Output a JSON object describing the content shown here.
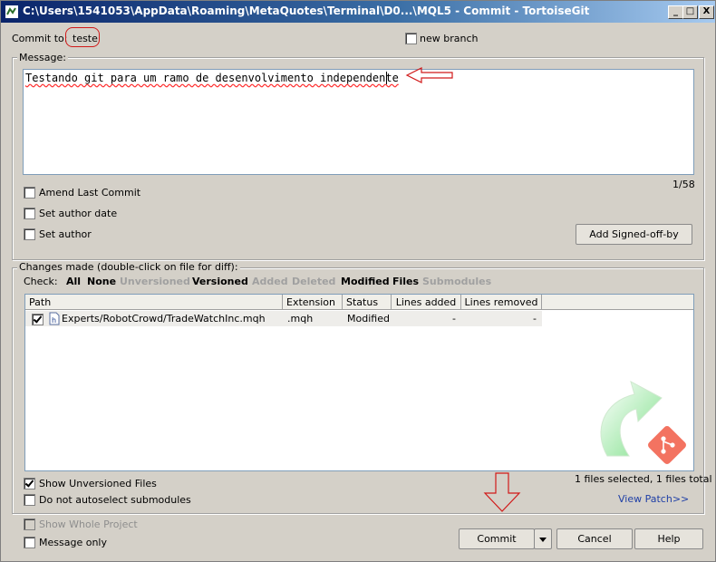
{
  "window": {
    "title": "C:\\Users\\1541053\\AppData\\Roaming\\MetaQuotes\\Terminal\\D0...\\MQL5 - Commit - TortoiseGit",
    "minimize": "_",
    "maximize": "□",
    "close": "X"
  },
  "commit_to": {
    "label": "Commit to:",
    "branch": "teste"
  },
  "new_branch": {
    "label": "new branch",
    "checked": false
  },
  "message": {
    "group_label": "Message:",
    "text": "Testando git para um ramo de desenvolvimento independente",
    "counter": "1/58"
  },
  "options": {
    "amend_label": "Amend Last Commit",
    "author_date_label": "Set author date",
    "author_label": "Set author",
    "signoff_button": "Add Signed-off-by"
  },
  "changes": {
    "group_label": "Changes made (double-click on file for diff):",
    "check_label": "Check:",
    "filters": [
      {
        "label": "All",
        "enabled": true
      },
      {
        "label": "None",
        "enabled": true
      },
      {
        "label": "Unversioned",
        "enabled": false
      },
      {
        "label": "Versioned",
        "enabled": true
      },
      {
        "label": "Added",
        "enabled": false
      },
      {
        "label": "Deleted",
        "enabled": false
      },
      {
        "label": "Modified",
        "enabled": true
      },
      {
        "label": "Files",
        "enabled": true
      },
      {
        "label": "Submodules",
        "enabled": false
      }
    ],
    "columns": [
      "Path",
      "Extension",
      "Status",
      "Lines added",
      "Lines removed"
    ],
    "rows": [
      {
        "checked": true,
        "path": "Experts/RobotCrowd/TradeWatchInc.mqh",
        "extension": ".mqh",
        "status": "Modified",
        "lines_added": "-",
        "lines_removed": "-"
      }
    ],
    "selection_summary": "1 files selected, 1 files total",
    "view_patch": "View Patch>>"
  },
  "bottom": {
    "show_unversioned": {
      "label": "Show Unversioned Files",
      "checked": true
    },
    "no_autoselect": {
      "label": "Do not autoselect submodules",
      "checked": false
    },
    "show_whole_project": {
      "label": "Show Whole Project",
      "checked": false,
      "enabled": false
    },
    "message_only": {
      "label": "Message only",
      "checked": false
    }
  },
  "buttons": {
    "commit": "Commit",
    "cancel": "Cancel",
    "help": "Help"
  },
  "colors": {
    "title_start": "#0a246a",
    "title_end": "#a6caf0",
    "annotation": "#d11919",
    "dialog_bg": "#d4d0c8",
    "link": "#1f3fa6"
  }
}
